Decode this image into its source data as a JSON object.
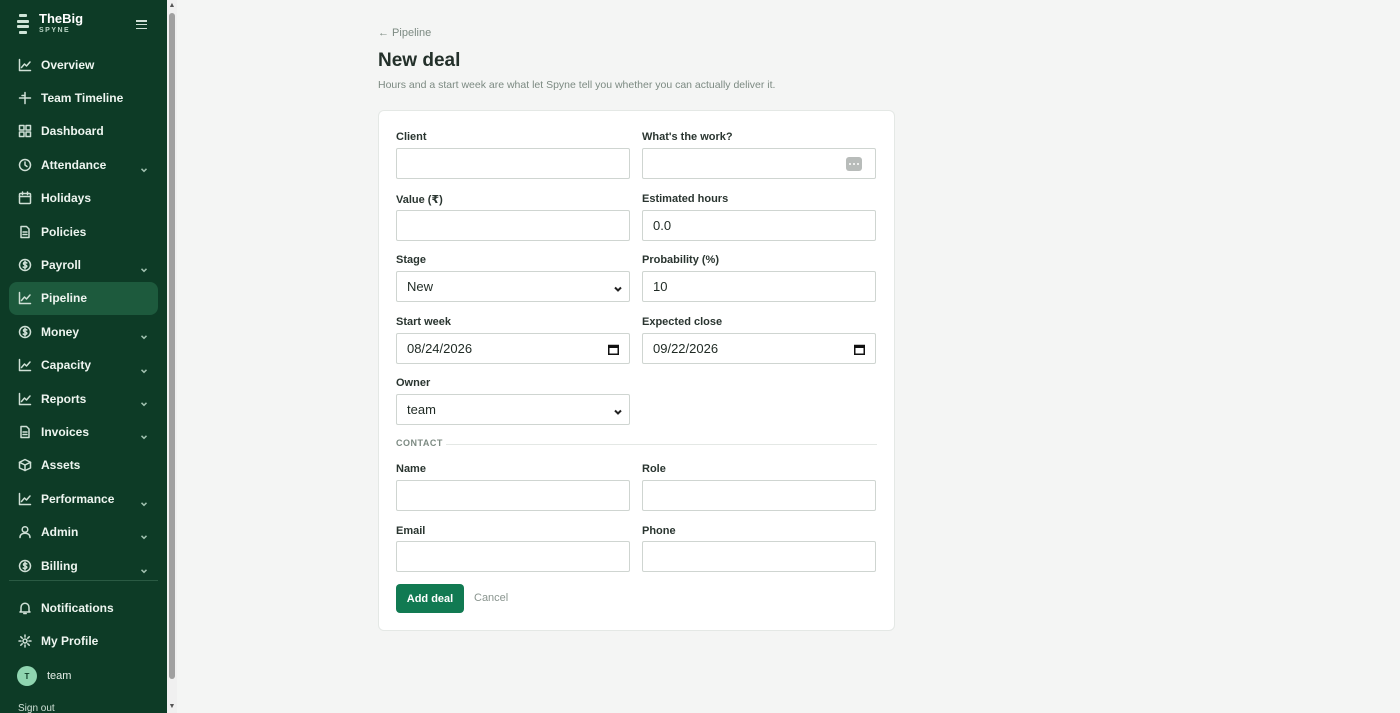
{
  "brand": {
    "name": "TheBig",
    "sub": "SPYNE"
  },
  "sidebar": {
    "items": [
      {
        "label": "Overview",
        "icon": "trend-chart-icon",
        "chevron": false,
        "active": false
      },
      {
        "label": "Team Timeline",
        "icon": "timeline-icon",
        "chevron": false,
        "active": false
      },
      {
        "label": "Dashboard",
        "icon": "grid-icon",
        "chevron": false,
        "active": false
      },
      {
        "label": "Attendance",
        "icon": "clock-icon",
        "chevron": true,
        "active": false
      },
      {
        "label": "Holidays",
        "icon": "calendar-icon",
        "chevron": false,
        "active": false
      },
      {
        "label": "Policies",
        "icon": "document-icon",
        "chevron": false,
        "active": false
      },
      {
        "label": "Payroll",
        "icon": "currency-icon",
        "chevron": true,
        "active": false
      },
      {
        "label": "Pipeline",
        "icon": "trend-chart-icon",
        "chevron": false,
        "active": true
      },
      {
        "label": "Money",
        "icon": "currency-icon",
        "chevron": true,
        "active": false
      },
      {
        "label": "Capacity",
        "icon": "trend-chart-icon",
        "chevron": true,
        "active": false
      },
      {
        "label": "Reports",
        "icon": "trend-chart-icon",
        "chevron": true,
        "active": false
      },
      {
        "label": "Invoices",
        "icon": "document-icon",
        "chevron": true,
        "active": false
      },
      {
        "label": "Assets",
        "icon": "box-icon",
        "chevron": false,
        "active": false
      },
      {
        "label": "Performance",
        "icon": "trend-chart-icon",
        "chevron": true,
        "active": false
      },
      {
        "label": "Admin",
        "icon": "user-icon",
        "chevron": true,
        "active": false
      },
      {
        "label": "Billing",
        "icon": "currency-icon",
        "chevron": true,
        "active": false
      }
    ],
    "bottom_items": [
      {
        "label": "Notifications",
        "icon": "bell-icon"
      },
      {
        "label": "My Profile",
        "icon": "gear-icon"
      }
    ],
    "user": {
      "initial": "T",
      "name": "team"
    },
    "signout": "Sign out"
  },
  "page": {
    "breadcrumb": "← Pipeline",
    "title": "New deal",
    "subtitle": "Hours and a start week are what let Spyne tell you whether you can actually deliver it."
  },
  "form": {
    "client": {
      "label": "Client",
      "value": ""
    },
    "work": {
      "label": "What's the work?",
      "value": ""
    },
    "value": {
      "label": "Value (₹)",
      "value": ""
    },
    "hours": {
      "label": "Estimated hours",
      "value": "0.0"
    },
    "stage": {
      "label": "Stage",
      "value": "New"
    },
    "probability": {
      "label": "Probability (%)",
      "value": "10"
    },
    "start_week": {
      "label": "Start week",
      "value": "08/24/2026"
    },
    "expected_close": {
      "label": "Expected close",
      "value": "09/22/2026"
    },
    "owner": {
      "label": "Owner",
      "value": "team"
    },
    "contact_section": "CONTACT",
    "contact_name": {
      "label": "Name",
      "value": ""
    },
    "contact_role": {
      "label": "Role",
      "value": ""
    },
    "contact_email": {
      "label": "Email",
      "value": ""
    },
    "contact_phone": {
      "label": "Phone",
      "value": ""
    },
    "submit": "Add deal",
    "cancel": "Cancel"
  }
}
